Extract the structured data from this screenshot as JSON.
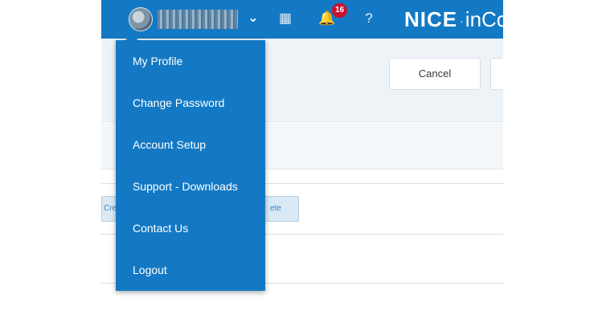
{
  "header": {
    "notification_count": "16",
    "brand_strong": "NICE",
    "brand_dot": "·",
    "brand_light": "inCo",
    "icons": {
      "user_avatar": "user-avatar",
      "user_menu_toggle": "chevron-down-icon",
      "board": "board-icon",
      "bell": "bell-icon",
      "help": "help-icon"
    }
  },
  "actions": {
    "cancel_label": "Cancel",
    "create_label_fragment": "Cre",
    "delete_label_fragment": "ete"
  },
  "user_menu": {
    "items": [
      {
        "label": "My Profile"
      },
      {
        "label": "Change Password"
      },
      {
        "label": "Account Setup"
      },
      {
        "label": "Support - Downloads"
      },
      {
        "label": "Contact Us"
      },
      {
        "label": "Logout"
      }
    ]
  },
  "colors": {
    "primary": "#1479c4",
    "badge": "#c8102e",
    "page_bg": "#eef3f8"
  }
}
